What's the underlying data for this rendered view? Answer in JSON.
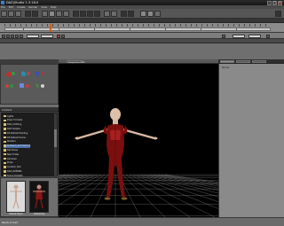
{
  "window": {
    "title": "DAZ|Studio 1.3.16.0"
  },
  "menubar": {
    "items": [
      "File",
      "Edit",
      "Create",
      "Render",
      "View",
      "Help"
    ]
  },
  "timeline": {
    "frame_fields": [
      "",
      "",
      "",
      ""
    ]
  },
  "panels": {
    "tools_header": "",
    "library_header": "Content",
    "right_panel_label": "Name"
  },
  "viewport": {
    "tab_label": "Perspective View"
  },
  "library": {
    "folders": [
      "Lights",
      "Poser Formats",
      "DAZ_Clothing",
      "DAZ Sample",
      "DS Default Shading",
      "DS Default Scene",
      "Shaders",
      "Software_Architecture",
      "Daz Poses",
      "New Folder",
      "Cameras",
      "Props",
      "Content_Hub",
      "DAZ_DOMINO",
      "Scene Subsets"
    ],
    "selected_index": 7
  },
  "thumbs": [
    {
      "caption": "Default Figure"
    },
    {
      "caption": "Default Rig"
    }
  ],
  "status": {
    "text": "Ready to load"
  },
  "colors": {
    "viewport_bg": "#000000",
    "floor_grid": "#9a9a9a",
    "figure_dress": "#7a0f0f",
    "figure_skin": "#d8b9a3",
    "timeline_key": "#d06010",
    "selection": "#4a6fa8"
  },
  "icons": [
    "app-icon",
    "minimize-icon",
    "maximize-icon",
    "close-icon",
    "folder-icon",
    "figure-thumb-icon"
  ]
}
